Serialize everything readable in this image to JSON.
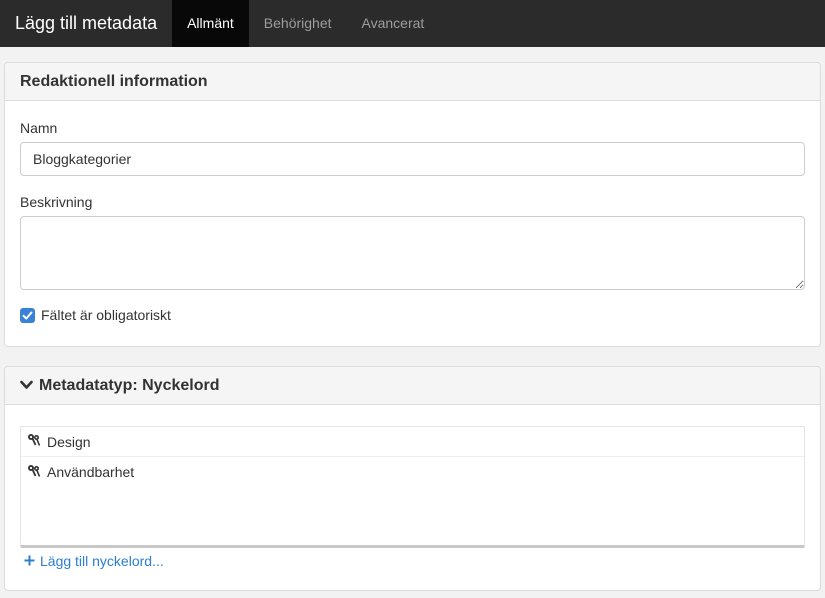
{
  "header": {
    "title": "Lägg till metadata",
    "tabs": [
      {
        "label": "Allmänt",
        "active": true
      },
      {
        "label": "Behörighet",
        "active": false
      },
      {
        "label": "Avancerat",
        "active": false
      }
    ]
  },
  "editorial": {
    "heading": "Redaktionell information",
    "name_label": "Namn",
    "name_value": "Bloggkategorier",
    "description_label": "Beskrivning",
    "description_value": "",
    "required_label": "Fältet är obligatoriskt",
    "required_checked": true
  },
  "metadata_type": {
    "heading": "Metadatatyp: Nyckelord",
    "keywords": [
      {
        "label": "Design",
        "icon": "keys-icon"
      },
      {
        "label": "Användbarhet",
        "icon": "keys-icon"
      }
    ],
    "add_label": "Lägg till nyckelord..."
  },
  "colors": {
    "topbar": "#2b2b2b",
    "active_tab": "#080808",
    "checkbox": "#3a82d6",
    "link": "#2a7fd0"
  }
}
